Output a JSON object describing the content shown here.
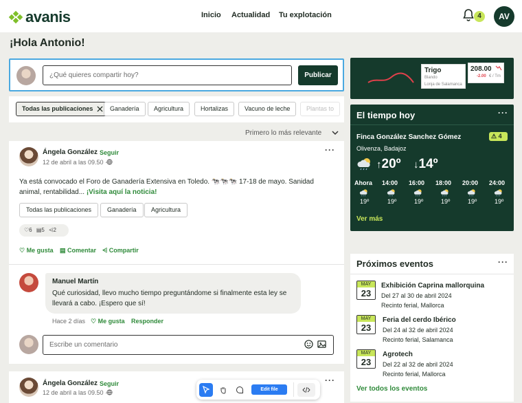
{
  "header": {
    "logo": "avanis",
    "nav": [
      "Inicio",
      "Actualidad",
      "Tu explotación"
    ],
    "notifications_count": "4",
    "user_initials": "AV"
  },
  "greeting": "¡Hola Antonio!",
  "composer": {
    "placeholder": "¿Qué quieres compartir hoy?",
    "publish_label": "Publicar"
  },
  "filters": [
    "Todas las publicaciones",
    "Ganadería",
    "Agricultura",
    "Hortalizas",
    "Vacuno de leche",
    "Plantas to"
  ],
  "sort_label": "Primero lo más relevante",
  "post1": {
    "author": "Ángela González",
    "follow": "Seguir",
    "date": "12 de abril a las 09.50 ·",
    "text": "Ya está convocado el Foro de Ganadería Extensiva en Toledo. 🐄🐄🐄 17-18 de mayo. Sanidad animal, rentabilidad...",
    "link": "¡Visita aquí la noticia!",
    "tags": [
      "Todas las publicaciones",
      "Ganadería",
      "Agricultura"
    ],
    "stats": {
      "likes": "6",
      "comments": "5",
      "shares": "2"
    },
    "actions": {
      "like": "Me gusta",
      "comment": "Comentar",
      "share": "Compartir"
    },
    "comment": {
      "author": "Manuel Martín",
      "text": "Qué curiosidad, llevo mucho tiempo preguntándome si finalmente esta ley se llevará a cabo. ¡Espero que sí!",
      "time": "Hace 2 días",
      "like": "Me gusta",
      "reply": "Responder"
    },
    "reply_placeholder": "Escribe un comentario"
  },
  "post2": {
    "author": "Ángela González",
    "follow": "Seguir",
    "date": "12 de abril a las 09.50 ·"
  },
  "market": {
    "product": "Trigo",
    "variety": "Blando",
    "market": "Lonja de Salamanca",
    "price": "208.00",
    "change": "-2.00",
    "unit": "€ / Tm",
    "trend_color": "#e0414b"
  },
  "weather": {
    "title": "El tiempo hoy",
    "farm": "Finca González Sanchez Gómez",
    "location": "Olivenza, Badajoz",
    "alerts": "4",
    "temp_max": "20º",
    "temp_min": "14º",
    "hours": [
      {
        "label": "Ahora",
        "temp": "19º"
      },
      {
        "label": "14:00",
        "temp": "19º"
      },
      {
        "label": "16:00",
        "temp": "19º"
      },
      {
        "label": "18:00",
        "temp": "19º"
      },
      {
        "label": "20:00",
        "temp": "19º"
      },
      {
        "label": "24:00",
        "temp": "19º"
      }
    ],
    "more": "Ver más"
  },
  "events": {
    "title": "Próximos eventos",
    "items": [
      {
        "month": "MAY",
        "day": "23",
        "name": "Exhibición Caprina mallorquina",
        "dates": "Del 27 al 30 de abril 2024",
        "place": "Recinto ferial, Mallorca"
      },
      {
        "month": "MAY",
        "day": "23",
        "name": "Feria del cerdo Ibérico",
        "dates": "Del 24 al 32 de abril 2024",
        "place": "Recinto ferial, Salamanca"
      },
      {
        "month": "MAY",
        "day": "23",
        "name": "Agrotech",
        "dates": "Del 22 al 32 de abril 2024",
        "place": "Recinto ferial, Mallorca"
      }
    ],
    "all": "Ver todos los eventos"
  },
  "toolbar": {
    "edit": "Edit file"
  },
  "colors": {
    "brand_dark": "#153a2c",
    "accent_green": "#2f8a3a",
    "lime": "#c8e65a",
    "focus_blue": "#49a8e0"
  }
}
